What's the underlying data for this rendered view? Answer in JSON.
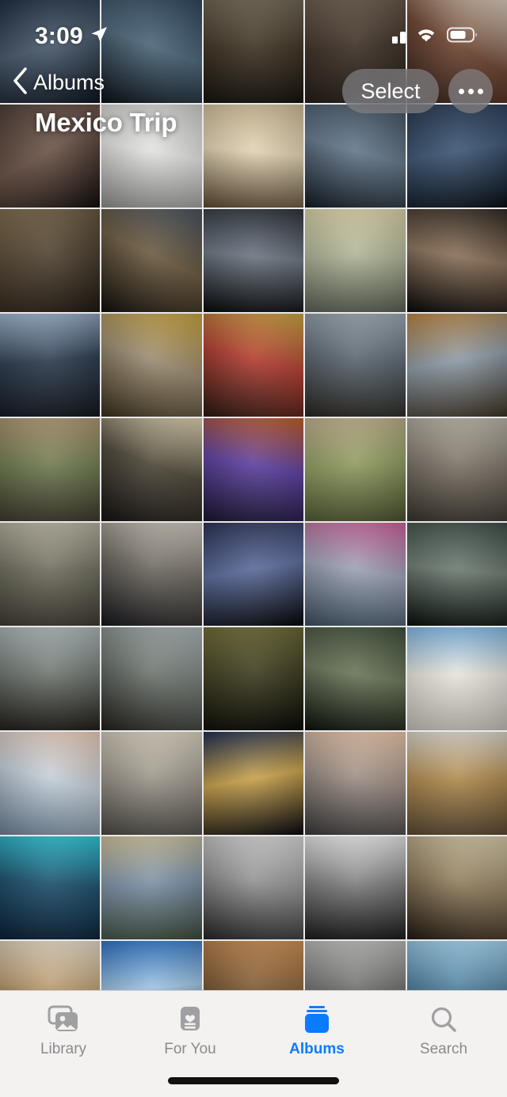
{
  "status_bar": {
    "time": "3:09",
    "location_icon": "location-arrow-icon",
    "cellular_icon": "cellular-signal-icon",
    "wifi_icon": "wifi-icon",
    "battery_icon": "battery-icon"
  },
  "nav": {
    "back_icon": "chevron-left-icon",
    "back_label": "Albums",
    "title": "Mexico Trip",
    "select_label": "Select",
    "more_icon": "ellipsis-icon"
  },
  "tabs": [
    {
      "label": "Library",
      "icon": "photos-library-icon",
      "active": false
    },
    {
      "label": "For You",
      "icon": "for-you-heart-card-icon",
      "active": false
    },
    {
      "label": "Albums",
      "icon": "albums-book-icon",
      "active": true
    },
    {
      "label": "Search",
      "icon": "magnifier-icon",
      "active": false
    }
  ],
  "colors": {
    "accent": "#0a7cff",
    "tab_inactive": "#8a8a8e",
    "tab_bar_bg": "#f3f2f0",
    "grid_gap": "#e9e9ea",
    "pill_bg": "rgba(140,140,146,0.62)"
  },
  "grid": {
    "columns": 5,
    "rows": 10,
    "photos": [
      {
        "name": "storefront-boiling-crab-at-dusk",
        "c1": "#1d2c3f",
        "c2": "#0c1520",
        "c3": "#47586b",
        "ang": 165
      },
      {
        "name": "window-reflection-dark-building",
        "c1": "#2c4258",
        "c2": "#0b1117",
        "c3": "#4b6578",
        "ang": 200
      },
      {
        "name": "outdoor-patio-gathering-evening",
        "c1": "#6b6250",
        "c2": "#181410",
        "c3": "#3d3222",
        "ang": 180
      },
      {
        "name": "group-photo-on-steps",
        "c1": "#6a5a4c",
        "c2": "#241c16",
        "c3": "#3a2e24",
        "ang": 175
      },
      {
        "name": "cocktail-glass-closeup",
        "c1": "#d9cdbd",
        "c2": "#2a1b14",
        "c3": "#6d4430",
        "ang": 210
      },
      {
        "name": "person-resting-dark-portrait",
        "c1": "#4a3c36",
        "c2": "#120d0b",
        "c3": "#6b5347",
        "ang": 150
      },
      {
        "name": "church-dome-grayscale-sky",
        "c1": "#c9c9c8",
        "c2": "#8d8d8c",
        "c3": "#e3e3e2",
        "ang": 190
      },
      {
        "name": "dog-on-bed-in-bedroom",
        "c1": "#cbb894",
        "c2": "#5c4a33",
        "c3": "#e2d3b4",
        "ang": 185
      },
      {
        "name": "city-skyline-highrise",
        "c1": "#3e4d5c",
        "c2": "#151c24",
        "c3": "#63778a",
        "ang": 195
      },
      {
        "name": "nbc-studios-marquee-night",
        "c1": "#243449",
        "c2": "#0a1018",
        "c3": "#3c5574",
        "ang": 170
      },
      {
        "name": "couple-kiss-in-park",
        "c1": "#7d6a4b",
        "c2": "#211a12",
        "c3": "#4e4130",
        "ang": 160
      },
      {
        "name": "pergola-store-sign-daytime",
        "c1": "#46505c",
        "c2": "#130f0b",
        "c3": "#6b5a3f",
        "ang": 205
      },
      {
        "name": "classic-car-at-night",
        "c1": "#2b2f36",
        "c2": "#08090b",
        "c3": "#6c7581",
        "ang": 185
      },
      {
        "name": "statue-of-liberty-from-water",
        "c1": "#d6cfa6",
        "c2": "#5c6257",
        "c3": "#aeb396",
        "ang": 180
      },
      {
        "name": "man-glasses-indoor-selfie",
        "c1": "#2d2722",
        "c2": "#0a0908",
        "c3": "#8a7058",
        "ang": 190
      },
      {
        "name": "black-car-side-window",
        "c1": "#9db4cc",
        "c2": "#14181e",
        "c3": "#2b3a4c",
        "ang": 175
      },
      {
        "name": "vintage-film-camera-closeup",
        "c1": "#c8a13a",
        "c2": "#3a2f1c",
        "c3": "#9b8c72",
        "ang": 200
      },
      {
        "name": "dog-in-front-of-christmas-tree",
        "c1": "#c6a23f",
        "c2": "#2a1a12",
        "c3": "#b13b30",
        "ang": 195
      },
      {
        "name": "couple-selfie-city-skyline",
        "c1": "#9aa6b0",
        "c2": "#2a2722",
        "c3": "#58636d",
        "ang": 185
      },
      {
        "name": "autumn-trees-along-street",
        "c1": "#b5813e",
        "c2": "#3d3324",
        "c3": "#8d9aa6",
        "ang": 170
      },
      {
        "name": "wooden-scaffold-garden",
        "c1": "#a9946f",
        "c2": "#3f3a2d",
        "c3": "#6e7a4f",
        "ang": 180
      },
      {
        "name": "woman-sunglasses-caramel-sign",
        "c1": "#ddd2b0",
        "c2": "#151313",
        "c3": "#4c4537",
        "ang": 200
      },
      {
        "name": "orange-sculpture-blue-lights",
        "c1": "#c05a26",
        "c2": "#1b1630",
        "c3": "#5b3fa0",
        "ang": 190
      },
      {
        "name": "dog-on-sidewalk-path",
        "c1": "#bfae8d",
        "c2": "#4b5230",
        "c3": "#8d9a5e",
        "ang": 175
      },
      {
        "name": "cat-asleep-on-bed",
        "c1": "#b9b3a6",
        "c2": "#3a342c",
        "c3": "#7a7266",
        "ang": 185
      },
      {
        "name": "dog-on-couch-living-room",
        "c1": "#b2ae9c",
        "c2": "#403c33",
        "c3": "#6d6c5c",
        "ang": 180
      },
      {
        "name": "dog-under-piano-bench",
        "c1": "#cdc6bb",
        "c2": "#17161a",
        "c3": "#6b675f",
        "ang": 195
      },
      {
        "name": "band-performing-on-stage",
        "c1": "#2a2f4f",
        "c2": "#060608",
        "c3": "#5a6a9a",
        "ang": 170
      },
      {
        "name": "woman-with-plush-toys-at-fair",
        "c1": "#c85f97",
        "c2": "#3d5060",
        "c3": "#9ca2b5",
        "ang": 190
      },
      {
        "name": "woman-walking-city-street-dusk",
        "c1": "#3c4a44",
        "c2": "#0b110e",
        "c3": "#6d7b72",
        "ang": 185
      },
      {
        "name": "woman-sunglasses-by-railway",
        "c1": "#a9b3b5",
        "c2": "#22201c",
        "c3": "#6d746e",
        "ang": 180
      },
      {
        "name": "woman-sunglasses-by-railway-2",
        "c1": "#a9b3b5",
        "c2": "#22201c",
        "c3": "#6d746e",
        "ang": 200
      },
      {
        "name": "silhouette-by-window-blinds",
        "c1": "#6e6a36",
        "c2": "#0a0a06",
        "c3": "#3b3a1e",
        "ang": 175
      },
      {
        "name": "couple-on-sofa-dim-room",
        "c1": "#3c4a38",
        "c2": "#0c120c",
        "c3": "#6a7558",
        "ang": 190
      },
      {
        "name": "apartment-building-blue-sky",
        "c1": "#7fb5e0",
        "c2": "#c6c3ba",
        "c3": "#e8e5dd",
        "ang": 180
      },
      {
        "name": "closeup-face-with-buildings",
        "c1": "#e8c9b6",
        "c2": "#6d8296",
        "c3": "#c4cfd8",
        "ang": 195
      },
      {
        "name": "paris-rooftops-from-balcony",
        "c1": "#d7cfbd",
        "c2": "#4c4a46",
        "c3": "#9b958a",
        "ang": 185
      },
      {
        "name": "illuminated-church-at-night",
        "c1": "#1d2c4e",
        "c2": "#07080f",
        "c3": "#c8a24a",
        "ang": 170
      },
      {
        "name": "smiling-woman-at-dinner",
        "c1": "#e7c4a8",
        "c2": "#3a3a3c",
        "c3": "#9b8d84",
        "ang": 190
      },
      {
        "name": "breakfast-table-from-above",
        "c1": "#d8d2c6",
        "c2": "#5c4a34",
        "c3": "#b08a4c",
        "ang": 180
      },
      {
        "name": "person-on-boat-looking-at-marina",
        "c1": "#2ec4d4",
        "c2": "#0d2136",
        "c3": "#1b4f6b",
        "ang": 185
      },
      {
        "name": "people-walking-on-promenade",
        "c1": "#cbbf98",
        "c2": "#3d4a3a",
        "c3": "#7a8fa5",
        "ang": 175
      },
      {
        "name": "black-and-white-tree-lined-street",
        "c1": "#d6d6d6",
        "c2": "#262626",
        "c3": "#8f8f8f",
        "ang": 190
      },
      {
        "name": "black-and-white-dinner-table",
        "c1": "#e2e2e2",
        "c2": "#1d1d1d",
        "c3": "#7d7d7d",
        "ang": 180
      },
      {
        "name": "man-selfie-close-to-camera",
        "c1": "#d5c9a8",
        "c2": "#231a12",
        "c3": "#8f7c5c",
        "ang": 195
      },
      {
        "name": "man-holding-small-dog",
        "c1": "#e2d7c4",
        "c2": "#141414",
        "c3": "#b99a6e",
        "ang": 185
      },
      {
        "name": "blue-pillar-at-ferry-terminal",
        "c1": "#2b6fc0",
        "c2": "#1a2a3d",
        "c3": "#9fc3e0",
        "ang": 175
      },
      {
        "name": "dog-in-shadow-patterned-light",
        "c1": "#c98c52",
        "c2": "#2e2014",
        "c3": "#7d5a34",
        "ang": 190
      },
      {
        "name": "subway-platform-yellow-line",
        "c1": "#b4b4b2",
        "c2": "#262625",
        "c3": "#6f6f6e",
        "ang": 180
      },
      {
        "name": "woman-looking-at-skyline-over-water",
        "c1": "#9fd0ea",
        "c2": "#1b3d55",
        "c3": "#4f7f9c",
        "ang": 185
      }
    ]
  }
}
